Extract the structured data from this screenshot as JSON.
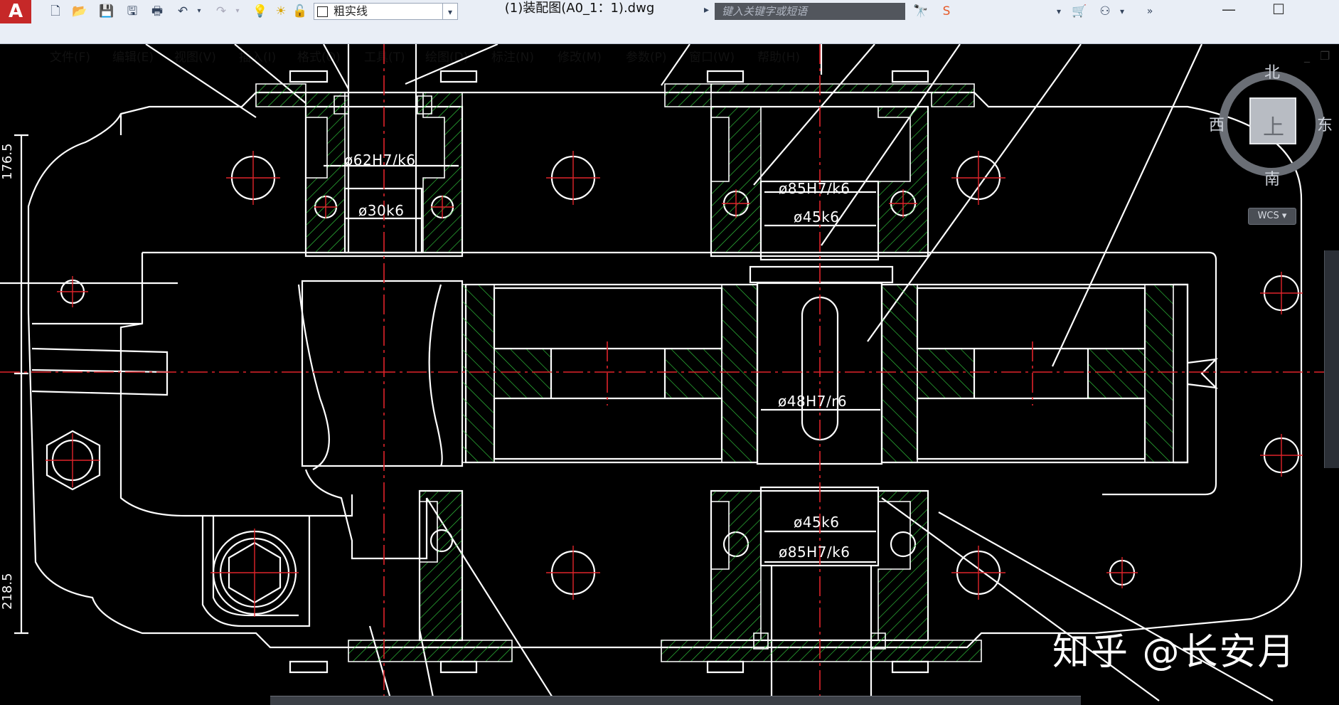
{
  "window": {
    "app_logo": "A",
    "document_title": "(1)装配图(A0_1：1).dwg",
    "search_placeholder": "键入关键字或短语",
    "minimize_glyph": "—",
    "maximize_glyph": "☐"
  },
  "quick_access": {
    "layer_name": "粗实线",
    "dropdown_glyph": "▾"
  },
  "menu": {
    "items": [
      "文件(F)",
      "编辑(E)",
      "视图(V)",
      "插入(I)",
      "格式(O)",
      "工具(T)",
      "绘图(D)",
      "标注(N)",
      "修改(M)",
      "参数(P)",
      "窗口(W)",
      "帮助(H)"
    ],
    "mdi_min": "_",
    "mdi_restore": "❐"
  },
  "dimensions": {
    "d1": "ø62H7/k6",
    "d2": "ø30k6",
    "d3": "ø85H7/k6",
    "d4": "ø45k6",
    "d5": "ø48H7/r6",
    "d6": "ø45k6",
    "d7": "ø85H7/k6",
    "v1": "176.5",
    "v2": "218.5"
  },
  "viewcube": {
    "north": "北",
    "south": "南",
    "east": "东",
    "west": "西",
    "top": "上",
    "wcs": "WCS"
  },
  "watermark": "知乎 @长安月",
  "colors": {
    "canvas": "#000000",
    "outline": "#ffffff",
    "centerline": "#e0242a",
    "hatch": "#2fbf3a"
  }
}
